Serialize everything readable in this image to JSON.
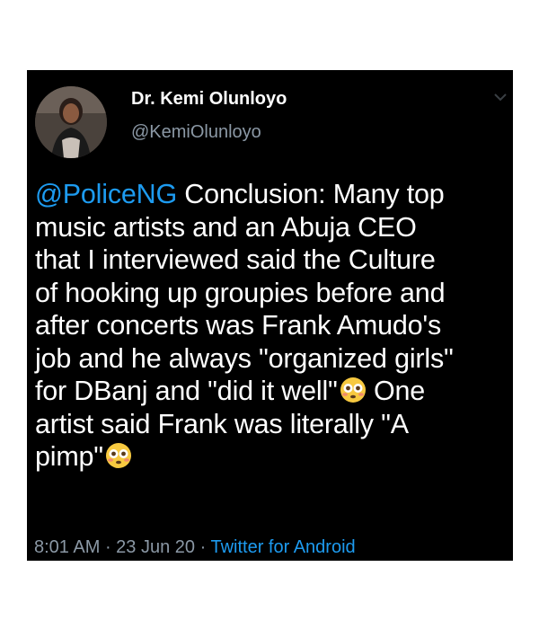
{
  "author": {
    "display_name": "Dr. Kemi Olunloyo",
    "handle": "@KemiOlunloyo"
  },
  "tweet": {
    "mention": "@PoliceNG",
    "line1_rest": " Conclusion: Many top",
    "line2": "music artists and an Abuja CEO",
    "line3": "that I interviewed said the Culture",
    "line4": "of hooking up groupies before and",
    "line5": "after concerts was Frank Amudo's",
    "line6": "job and he always \"organized girls\"",
    "line7_before": "for DBanj and \"did it well\"",
    "line7_after": " One",
    "line8": "artist said Frank was literally \"A",
    "line9": "pimp\""
  },
  "meta": {
    "time": "8:01 AM",
    "sep1": " · ",
    "date": "23 Jun 20",
    "sep2": " · ",
    "source": "Twitter for Android"
  },
  "icons": {
    "emoji": "flushed-face-emoji",
    "menu": "chevron-down-icon"
  },
  "colors": {
    "background": "#000000",
    "text": "#ffffff",
    "secondary": "#8b98a5",
    "link": "#1d9bf0"
  }
}
